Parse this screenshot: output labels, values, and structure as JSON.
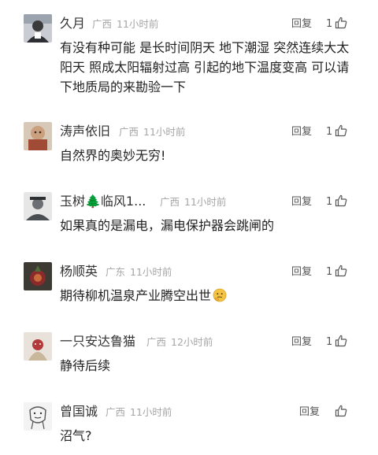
{
  "comments": [
    {
      "user": "久月",
      "region": "广西",
      "time": "11小时前",
      "reply_label": "回复",
      "likes": "1",
      "text": "有没有种可能 是长时间阴天 地下潮湿 突然连续大太阳天 照成太阳辐射过高 引起的地下温度变高 可以请下地质局的来勘验一下"
    },
    {
      "user": "涛声依旧",
      "region": "广西",
      "time": "11小时前",
      "reply_label": "回复",
      "likes": "1",
      "text": "自然界的奥妙无穷!"
    },
    {
      "user": "玉树🌲临风1...",
      "region": "广西",
      "time": "11小时前",
      "reply_label": "回复",
      "likes": "1",
      "text": "如果真的是漏电，漏电保护器会跳闸的"
    },
    {
      "user": "杨顺英",
      "region": "广东",
      "time": "11小时前",
      "reply_label": "回复",
      "likes": "1",
      "text": "期待柳机温泉产业腾空出世"
    },
    {
      "user": "一只安达鲁猫",
      "region": "广西",
      "time": "12小时前",
      "reply_label": "回复",
      "likes": "1",
      "text": "静待后续"
    },
    {
      "user": "曾国诚",
      "region": "广西",
      "time": "11小时前",
      "reply_label": "回复",
      "likes": "",
      "text": "沼气?"
    }
  ],
  "icons": {
    "like": "thumbs-up-icon",
    "emoji": "thinking-face-emoji"
  },
  "colors": {
    "username": "#333333",
    "meta": "#a6a6a6",
    "body_text": "#222222"
  }
}
